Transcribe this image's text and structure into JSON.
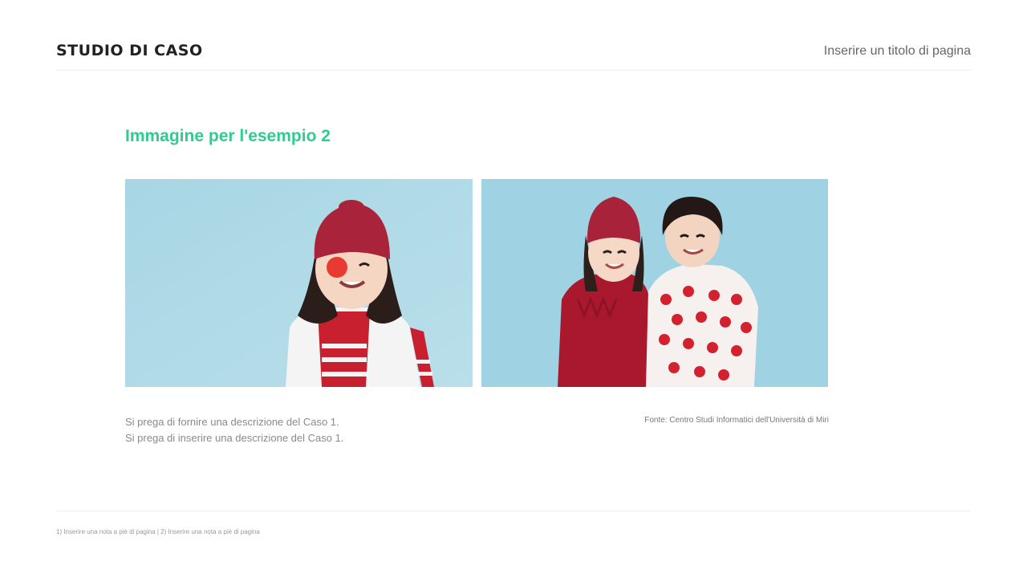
{
  "header": {
    "title": "STUDIO DI CASO",
    "page_title": "Inserire un titolo di pagina"
  },
  "main": {
    "heading": "Immagine per l'esempio 2",
    "images": [
      {
        "subject": "girl with red knit hat and clown nose on light blue background"
      },
      {
        "subject": "two children in red knit sweaters hugging on light blue background"
      }
    ],
    "description_lines": [
      "Si prega di fornire una descrizione del Caso 1.",
      "Si prega di inserire una descrizione del Caso 1."
    ],
    "source": "Fonte: Centro Studi Informatici dell'Università di Miri"
  },
  "footer": {
    "footnote": "1) Inserire una nota a piè di pagina | 2) Inserire una nota a piè di pagina"
  },
  "colors": {
    "accent": "#2ecc8f",
    "photo_background": "#a9d8e6",
    "knit_red": "#b3182f"
  }
}
